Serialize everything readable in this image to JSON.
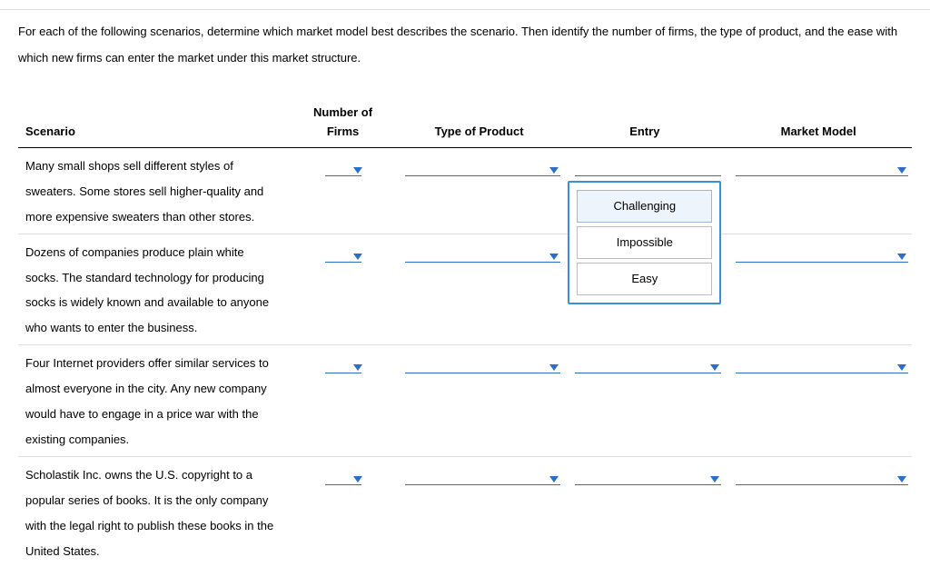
{
  "instructions": "For each of the following scenarios, determine which market model best describes the scenario. Then identify the number of firms, the type of product, and the ease with which new firms can enter the market under this market structure.",
  "columns": {
    "scenario": "Scenario",
    "firms_line1": "Number of",
    "firms_line2": "Firms",
    "product": "Type of Product",
    "entry": "Entry",
    "model": "Market Model"
  },
  "rows": [
    {
      "scenario": "Many small shops sell different styles of sweaters. Some stores sell higher-quality and more expensive sweaters than other stores."
    },
    {
      "scenario": "Dozens of companies produce plain white socks. The standard technology for producing socks is widely known and available to anyone who wants to enter the business."
    },
    {
      "scenario": "Four Internet providers offer similar services to almost everyone in the city. Any new company would have to engage in a price war with the existing companies."
    },
    {
      "scenario": "Scholastik Inc. owns the U.S. copyright to a popular series of books. It is the only company with the legal right to publish these books in the United States."
    }
  ],
  "dropdown_open": {
    "row": 0,
    "options": [
      "Challenging",
      "Impossible",
      "Easy"
    ]
  }
}
